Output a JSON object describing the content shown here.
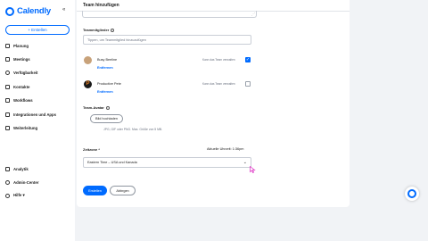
{
  "app": {
    "name": "Calendly",
    "collapse_glyph": "«"
  },
  "sidebar": {
    "create_label": "+ Erstellen",
    "items": [
      {
        "label": "Planung",
        "icon": "link-icon"
      },
      {
        "label": "Meetings",
        "icon": "calendar-icon"
      },
      {
        "label": "Verfügbarkeit",
        "icon": "clock-icon"
      },
      {
        "label": "Kontakte",
        "icon": "contacts-icon"
      },
      {
        "label": "Workflows",
        "icon": "workflow-icon"
      },
      {
        "label": "Integrationen und Apps",
        "icon": "apps-grid-icon"
      },
      {
        "label": "Weiterleitung",
        "icon": "routing-icon"
      }
    ],
    "bottom_items": [
      {
        "label": "Analytik",
        "icon": "analytics-icon"
      },
      {
        "label": "Admin-Center",
        "icon": "admin-icon"
      },
      {
        "label": "Hilfe ▾",
        "icon": "help-icon"
      }
    ]
  },
  "panel": {
    "title": "Team hinzufügen",
    "members_label": "Teammitglieder",
    "members_placeholder": "Tippen, um Teammitglied hinzuzufügen",
    "members": [
      {
        "name": "Busy Beeline",
        "remove": "Entfernen",
        "manage": "Kann das Team verwalten",
        "checked": true,
        "avatar_color": "#c8a27a"
      },
      {
        "name": "Productive Pete",
        "remove": "Entfernen",
        "manage": "Kann das Team verwalten",
        "checked": false,
        "avatar_color": "#b5541c"
      }
    ],
    "avatar_label": "Team-Avatar",
    "upload_label": "Bild hochladen",
    "upload_hint": "JPG, GIF oder PNG. Max. Größe von 5 MB.",
    "timezone_label": "Zeitzone *",
    "timezone_current": "Aktuelle Uhrzeit: 1:36pm",
    "timezone_value": "Eastern Time – USA und Kanada",
    "create_button": "Erstellen",
    "cancel_button": "Abbrgen"
  },
  "colors": {
    "brand": "#006bff",
    "cursor": "#e040c8"
  }
}
